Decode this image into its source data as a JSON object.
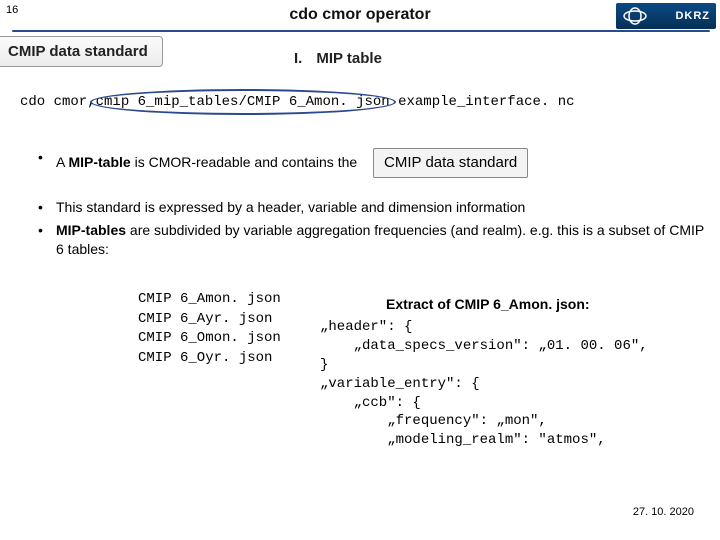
{
  "page_number": "16",
  "header": {
    "title": "cdo cmor operator",
    "logo_text": "DKRZ"
  },
  "tab_label": "CMIP data standard",
  "section": {
    "roman": "I.",
    "label": "MIP table"
  },
  "command": {
    "pre": "cdo cmor,",
    "circled": "cmip 6_mip_tables/CMIP 6_Amon. json",
    "post": " example_interface. nc"
  },
  "bullets": {
    "b1_pre": "A ",
    "b1_strong": "MIP-table",
    "b1_rest": " is CMOR-readable and contains the",
    "badge": "CMIP data standard",
    "b2": "This standard is expressed by a header, variable and dimension information",
    "b3_strong": "MIP-tables",
    "b3_rest": " are subdivided by variable aggregation frequencies (and realm). e.g. this is a subset of CMIP 6 tables:"
  },
  "files": [
    "CMIP 6_Amon. json",
    "CMIP 6_Ayr. json",
    "CMIP 6_Omon. json",
    "CMIP 6_Oyr. json"
  ],
  "extract_title": "Extract of CMIP 6_Amon. json:",
  "json_text": "„header\": {\n    „data_specs_version\": „01. 00. 06\",\n}\n„variable_entry\": {\n    „ccb\": {\n        „frequency\": „mon\",\n        „modeling_realm\": \"atmos\",",
  "footer_date": "27. 10. 2020"
}
